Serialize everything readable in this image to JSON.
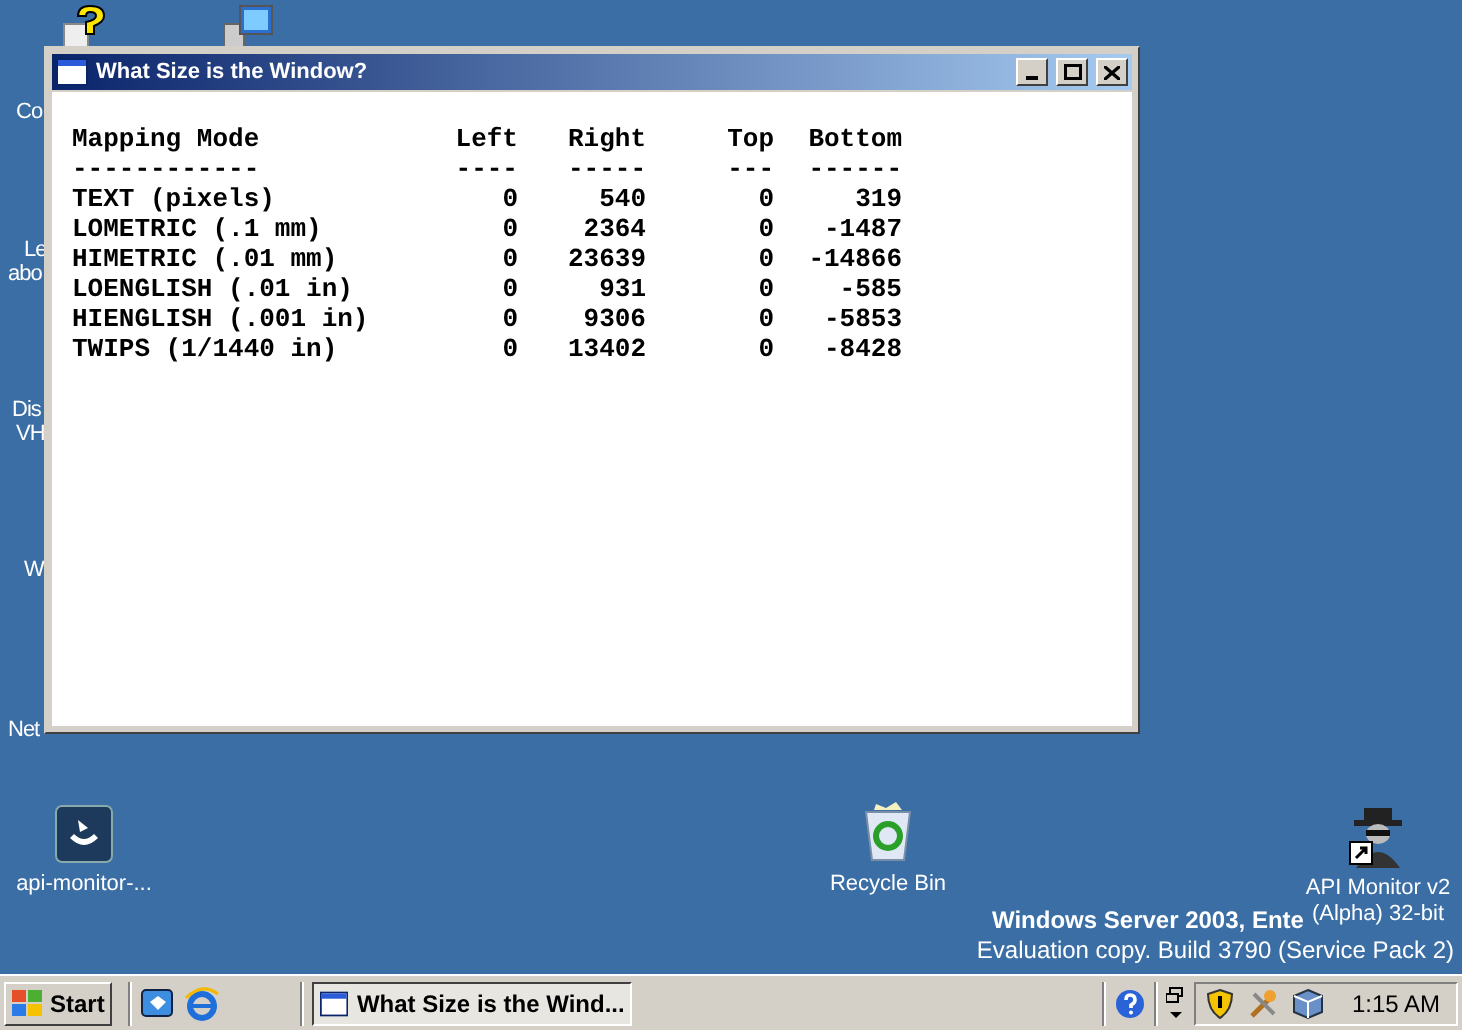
{
  "desktop": {
    "cut_labels": [
      "Co",
      "Le",
      "abo",
      "Dis",
      "VH",
      "W",
      "Net"
    ],
    "icons": [
      {
        "label": "api-monitor-..."
      },
      {
        "label": "Recycle Bin"
      },
      {
        "label": "API Monitor v2 (Alpha) 32-bit"
      }
    ],
    "notice": {
      "edition": "Windows Server 2003, Ente",
      "build": "Evaluation copy. Build 3790 (Service Pack 2)"
    }
  },
  "window": {
    "title": "What Size is the Window?",
    "table": {
      "columns": [
        {
          "heading": "Mapping Mode",
          "rule": "------------"
        },
        {
          "heading": "Left",
          "rule": "----"
        },
        {
          "heading": "Right",
          "rule": "-----"
        },
        {
          "heading": "Top",
          "rule": "---"
        },
        {
          "heading": "Bottom",
          "rule": "------"
        }
      ],
      "rows": [
        [
          "TEXT (pixels)",
          "0",
          "540",
          "0",
          "319"
        ],
        [
          "LOMETRIC (.1 mm)",
          "0",
          "2364",
          "0",
          "-1487"
        ],
        [
          "HIMETRIC (.01 mm)",
          "0",
          "23639",
          "0",
          "-14866"
        ],
        [
          "LOENGLISH (.01 in)",
          "0",
          "931",
          "0",
          "-585"
        ],
        [
          "HIENGLISH (.001 in)",
          "0",
          "9306",
          "0",
          "-5853"
        ],
        [
          "TWIPS (1/1440 in)",
          "0",
          "13402",
          "0",
          "-8428"
        ]
      ]
    }
  },
  "taskbar": {
    "start": "Start",
    "tasks": [
      {
        "label": "What Size is the Wind...",
        "selected": true
      }
    ],
    "clock": "1:15 AM"
  }
}
